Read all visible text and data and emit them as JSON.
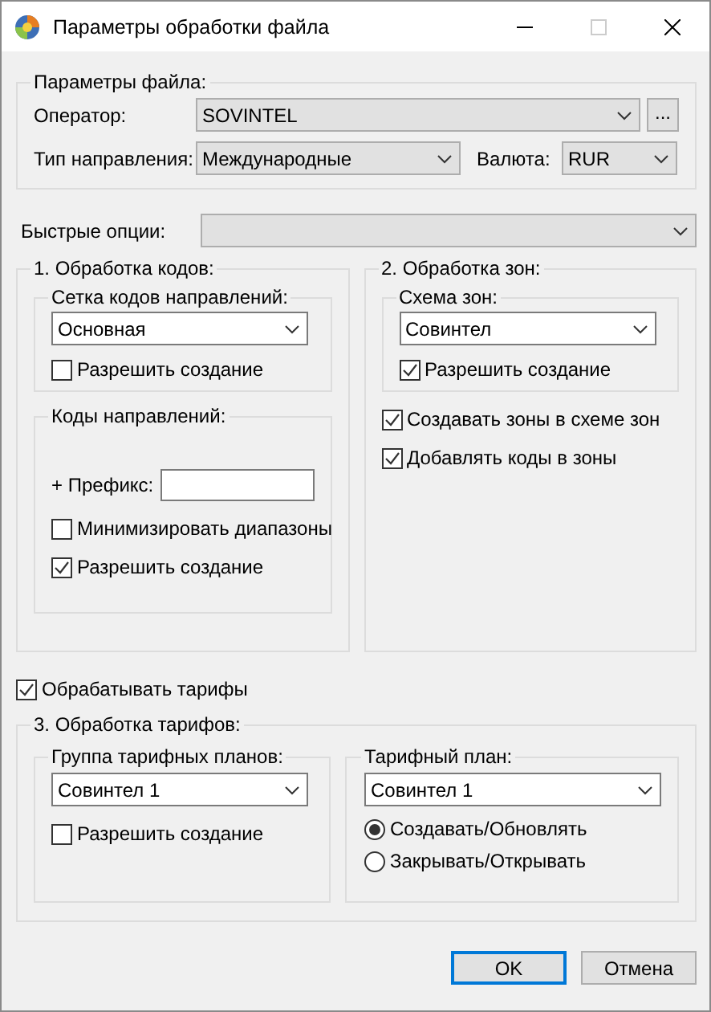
{
  "window": {
    "title": "Параметры обработки файла"
  },
  "file_params": {
    "title": "Параметры файла:",
    "operator": {
      "label": "Оператор:",
      "value": "SOVINTEL",
      "browse": "..."
    },
    "direction_type": {
      "label": "Тип направления:",
      "value": "Международные"
    },
    "currency": {
      "label": "Валюта:",
      "value": "RUR"
    }
  },
  "quick_options": {
    "label": "Быстрые опции:"
  },
  "codes": {
    "title": "1. Обработка кодов:",
    "grid": {
      "title": "Сетка кодов направлений:",
      "value": "Основная",
      "checkboxes": [
        {
          "label": "Разрешить создание",
          "checked": false
        }
      ]
    },
    "dir_codes": {
      "title": "Коды направлений:",
      "prefix_label": "+ Префикс:",
      "checkboxes": [
        {
          "label": "Минимизировать диапазоны",
          "checked": false
        },
        {
          "label": "Разрешить создание",
          "checked": true
        }
      ]
    }
  },
  "zones": {
    "title": "2. Обработка зон:",
    "scheme": {
      "title": "Схема зон:",
      "value": "Совинтел",
      "checkboxes": [
        {
          "label": "Разрешить создание",
          "checked": true
        }
      ]
    },
    "checkboxes": [
      {
        "label": "Создавать зоны в схеме зон",
        "checked": true
      },
      {
        "label": "Добавлять коды в зоны",
        "checked": true
      }
    ]
  },
  "process_tariffs": {
    "label": "Обрабатывать тарифы",
    "checked": true
  },
  "tariffs": {
    "title": "3. Обработка тарифов:",
    "group": {
      "title": "Группа тарифных планов:",
      "value": "Совинтел 1",
      "checkboxes": [
        {
          "label": "Разрешить создание",
          "checked": false
        }
      ]
    },
    "plan": {
      "title": "Тарифный план:",
      "value": "Совинтел 1",
      "radios": [
        {
          "label": "Создавать/Обновлять",
          "selected": true
        },
        {
          "label": "Закрывать/Открывать",
          "selected": false
        }
      ]
    }
  },
  "buttons": [
    {
      "label": "OK",
      "default": true
    },
    {
      "label": "Отмена",
      "default": false
    }
  ]
}
